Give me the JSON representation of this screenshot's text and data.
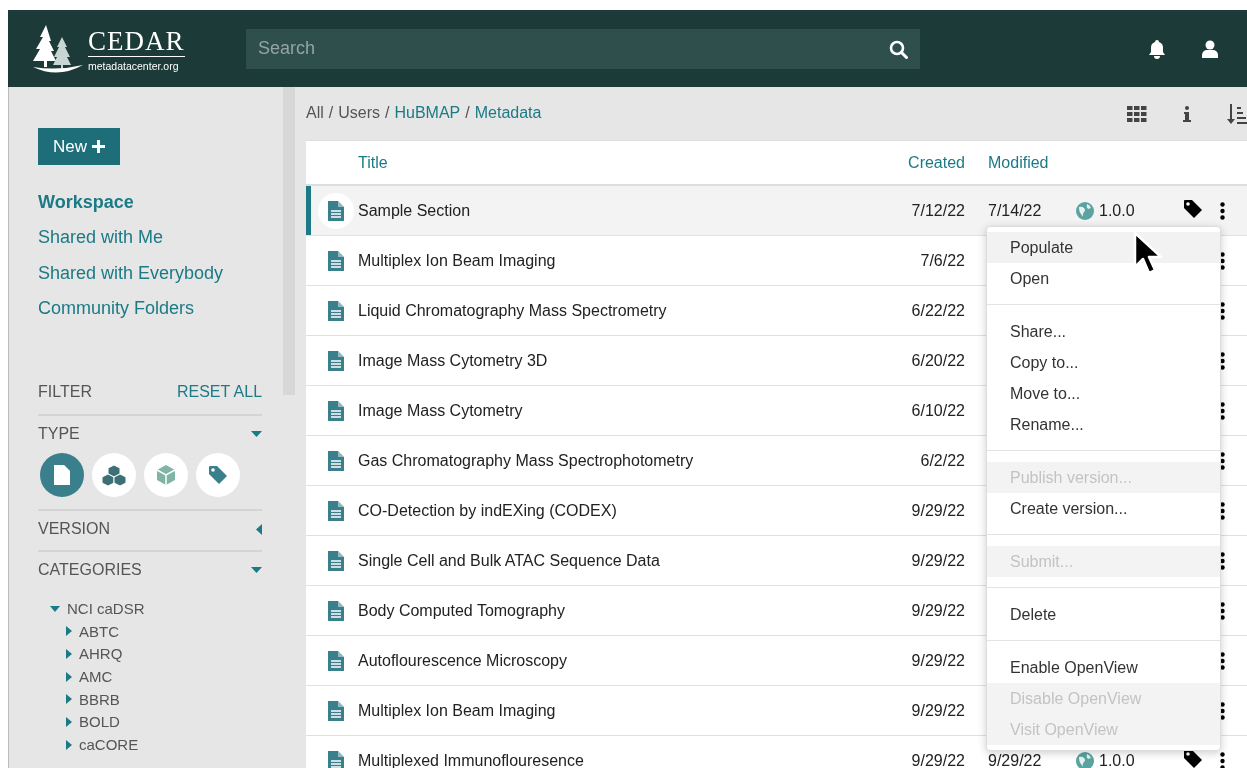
{
  "header": {
    "logo_title": "CEDAR",
    "logo_subtitle": "metadatacenter.org",
    "search": {
      "placeholder": "Search"
    }
  },
  "sidebar": {
    "new_button": "New",
    "nav": [
      {
        "label": "Workspace",
        "selected": true
      },
      {
        "label": "Shared with Me",
        "selected": false
      },
      {
        "label": "Shared with Everybody",
        "selected": false
      },
      {
        "label": "Community Folders",
        "selected": false
      }
    ],
    "filter": {
      "title": "FILTER",
      "reset": "RESET ALL",
      "sections": [
        {
          "label": "TYPE",
          "expanded": true,
          "types": [
            {
              "kind": "document",
              "selected": true
            },
            {
              "kind": "blocks",
              "selected": false
            },
            {
              "kind": "cube",
              "selected": false
            },
            {
              "kind": "tag",
              "selected": false
            }
          ]
        },
        {
          "label": "VERSION",
          "expanded": false
        },
        {
          "label": "CATEGORIES",
          "expanded": true,
          "tree": [
            {
              "label": "NCI caDSR",
              "expanded": true,
              "children": [
                {
                  "label": "ABTC",
                  "expanded": false
                },
                {
                  "label": "AHRQ",
                  "expanded": false
                },
                {
                  "label": "AMC",
                  "expanded": false
                },
                {
                  "label": "BBRB",
                  "expanded": false
                },
                {
                  "label": "BOLD",
                  "expanded": false
                },
                {
                  "label": "caCORE",
                  "expanded": false
                }
              ]
            }
          ]
        }
      ]
    }
  },
  "main": {
    "breadcrumb": {
      "separator": "/",
      "items": [
        {
          "label": "All",
          "link": false
        },
        {
          "label": "Users",
          "link": false
        },
        {
          "label": "HuBMAP",
          "link": true
        },
        {
          "label": "Metadata",
          "link": true
        }
      ]
    },
    "table": {
      "columns": [
        "Title",
        "Created",
        "Modified"
      ],
      "rows": [
        {
          "title": "Sample Section",
          "created": "7/12/22",
          "modified": "7/14/22",
          "version": "1.0.0",
          "selected": true
        },
        {
          "title": "Multiplex Ion Beam Imaging",
          "created": "7/6/22",
          "selected": false
        },
        {
          "title": "Liquid Chromatography Mass Spectrometry",
          "created": "6/22/22",
          "selected": false
        },
        {
          "title": "Image Mass Cytometry 3D",
          "created": "6/20/22",
          "selected": false
        },
        {
          "title": "Image Mass Cytometry",
          "created": "6/10/22",
          "selected": false
        },
        {
          "title": "Gas Chromatography Mass Spectrophotometry",
          "created": "6/2/22",
          "selected": false
        },
        {
          "title": "CO-Detection by indEXing (CODEX)",
          "created": "9/29/22",
          "selected": false
        },
        {
          "title": "Single Cell and Bulk ATAC Sequence Data",
          "created": "9/29/22",
          "selected": false
        },
        {
          "title": "Body Computed Tomography",
          "created": "9/29/22",
          "selected": false
        },
        {
          "title": "Autoflourescence Microscopy",
          "created": "9/29/22",
          "selected": false
        },
        {
          "title": "Multiplex Ion Beam Imaging",
          "created": "9/29/22",
          "selected": false
        },
        {
          "title": "Multiplexed Immunoflouresence",
          "created": "9/29/22",
          "modified": "9/29/22",
          "version": "1.0.0",
          "selected": false
        }
      ]
    },
    "context_menu": [
      {
        "kind": "item",
        "label": "Populate",
        "highlighted": true,
        "disabled": false
      },
      {
        "kind": "item",
        "label": "Open",
        "highlighted": false,
        "disabled": false
      },
      {
        "kind": "separator"
      },
      {
        "kind": "item",
        "label": "Share...",
        "highlighted": false,
        "disabled": false
      },
      {
        "kind": "item",
        "label": "Copy to...",
        "highlighted": false,
        "disabled": false
      },
      {
        "kind": "item",
        "label": "Move to...",
        "highlighted": false,
        "disabled": false
      },
      {
        "kind": "item",
        "label": "Rename...",
        "highlighted": false,
        "disabled": false
      },
      {
        "kind": "separator"
      },
      {
        "kind": "item",
        "label": "Publish version...",
        "highlighted": false,
        "disabled": true
      },
      {
        "kind": "item",
        "label": "Create version...",
        "highlighted": false,
        "disabled": false
      },
      {
        "kind": "separator"
      },
      {
        "kind": "item",
        "label": "Submit...",
        "highlighted": false,
        "disabled": true
      },
      {
        "kind": "separator"
      },
      {
        "kind": "item",
        "label": "Delete",
        "highlighted": false,
        "disabled": false
      },
      {
        "kind": "separator"
      },
      {
        "kind": "item",
        "label": "Enable OpenView",
        "highlighted": false,
        "disabled": false
      },
      {
        "kind": "item",
        "label": "Disable OpenView",
        "highlighted": false,
        "disabled": true
      },
      {
        "kind": "item",
        "label": "Visit OpenView",
        "highlighted": false,
        "disabled": true
      }
    ]
  }
}
